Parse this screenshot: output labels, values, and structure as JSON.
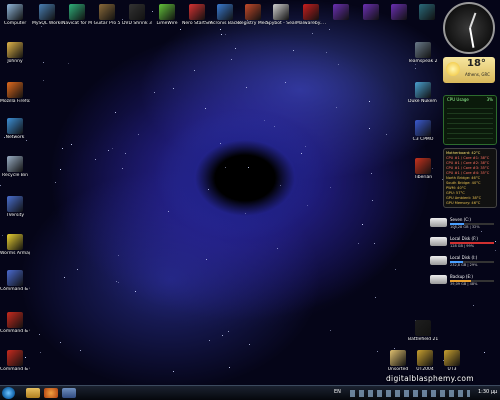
{
  "desktop": {
    "top_row": [
      {
        "label": "Computer",
        "icon": "computer-icon",
        "color": "#8fb5d9"
      },
      {
        "label": "MySQL Workstation",
        "icon": "mysql-workbench-icon",
        "color": "#4a7fb3"
      },
      {
        "label": "Navicat for MySQL",
        "icon": "navicat-icon",
        "color": "#2fb07a"
      },
      {
        "label": "Guitar Pro 5",
        "icon": "guitar-pro-icon",
        "color": "#8a6a3a"
      },
      {
        "label": "DVD Shrink 3.2",
        "icon": "dvd-shrink-icon",
        "color": "#333333"
      },
      {
        "label": "LimeWire",
        "icon": "limewire-icon",
        "color": "#63c13b"
      },
      {
        "label": "Nero StartSmart",
        "icon": "nero-icon",
        "color": "#d63232"
      },
      {
        "label": "Acronis Backup &...",
        "icon": "acronis-icon",
        "color": "#3a7ad0"
      },
      {
        "label": "Registry Mechanic",
        "icon": "registry-mechanic-icon",
        "color": "#c44a2a"
      },
      {
        "label": "Spybot - Search ...",
        "icon": "spybot-icon",
        "color": "#cfcfcf"
      },
      {
        "label": "Malwareby... Anti-Malw...",
        "icon": "malwarebytes-icon",
        "color": "#c81e1e"
      },
      {
        "label": "",
        "icon": "tool-icon-1",
        "color": "#6a2fb3"
      },
      {
        "label": "",
        "icon": "tool-icon-2",
        "color": "#6a2fb3"
      },
      {
        "label": "",
        "icon": "tool-icon-3",
        "color": "#6a2fb3"
      },
      {
        "label": "",
        "icon": "tool-icon-p",
        "color": "#2a6a7a"
      }
    ],
    "left_column": [
      {
        "label": "Johnny",
        "icon": "user-folder-icon",
        "color": "#e0b44a"
      },
      {
        "label": "Mozilla Firefox",
        "icon": "firefox-icon",
        "color": "#e06a1e"
      },
      {
        "label": "Network",
        "icon": "network-icon",
        "color": "#3d8fd6"
      },
      {
        "label": "Recycle Bin",
        "icon": "recycle-bin-icon",
        "color": "#9aaec4"
      },
      {
        "label": "TVersity",
        "icon": "tversity-icon",
        "color": "#4a6fd0"
      },
      {
        "label": "Worms Armageddon",
        "icon": "worms-icon",
        "color": "#e8d032"
      },
      {
        "label": "Command & Conquer...",
        "icon": "command-conquer-icon",
        "color": "#4a6ad0"
      },
      {
        "label": "Command & Conquer...",
        "icon": "command-conquer-icon",
        "color": "#c82a1e"
      },
      {
        "label": "Command & Conquer...",
        "icon": "command-conquer-icon",
        "color": "#c82a1e"
      }
    ],
    "right_column": [
      {
        "label": "Teamspeak 2 RC2",
        "icon": "teamspeak-icon",
        "color": "#6a7a8a"
      },
      {
        "label": "Duke Nukem 3D",
        "icon": "duke-nukem-icon",
        "color": "#4aa0d0"
      },
      {
        "label": "C3 CPMO",
        "icon": "c3-icon",
        "color": "#3a5ad0"
      },
      {
        "label": "Tiberian",
        "icon": "tiberian-icon",
        "color": "#c8321e"
      },
      {
        "label": "Battlefield 2142",
        "icon": "battlefield-icon",
        "color": "#1e1e1e"
      }
    ],
    "bottom_row": [
      {
        "label": "Unsorted",
        "icon": "folder-icon",
        "color": "#e0c070"
      },
      {
        "label": "UT2004",
        "icon": "ut2004-icon",
        "color": "#c8a030"
      },
      {
        "label": "UT3",
        "icon": "ut3-icon",
        "color": "#c8a030"
      }
    ]
  },
  "gadgets": {
    "weather": {
      "temp": "18°",
      "location": "Athens, GRC"
    },
    "cpu": {
      "title": "CPU Usage",
      "value": "3%"
    },
    "temps": {
      "lines": [
        "Motherboard: 42°C",
        "CPU #1 / Core #1: 38°C",
        "CPU #1 / Core #2: 38°C",
        "CPU #1 / Core #3: 35°C",
        "CPU #1 / Core #4: 35°C",
        "North Bridge: 46°C",
        "South Bridge: 40°C",
        "PWM: 40°C",
        "GPU: 57°C",
        "GPU Ambient: 38°C",
        "GPU Memory: 46°C"
      ]
    },
    "drives": [
      {
        "name": "Seven (C:)",
        "size": "108,28 GB | 32%",
        "fill": 0.32,
        "color": "#4aa0ff"
      },
      {
        "name": "Local Disk (F:)",
        "size": "128 GB | 99%",
        "fill": 0.99,
        "color": "#d03030"
      },
      {
        "name": "Local Disk (I:)",
        "size": "232,8 GB | 29%",
        "fill": 0.29,
        "color": "#4aa0ff"
      },
      {
        "name": "Backup (E:)",
        "size": "39,09 GB | 48%",
        "fill": 0.48,
        "color": "#e8a030"
      }
    ]
  },
  "watermark": "digitalblasphemy.com",
  "taskbar": {
    "time": "1:30 μμ",
    "lang": "EN"
  }
}
